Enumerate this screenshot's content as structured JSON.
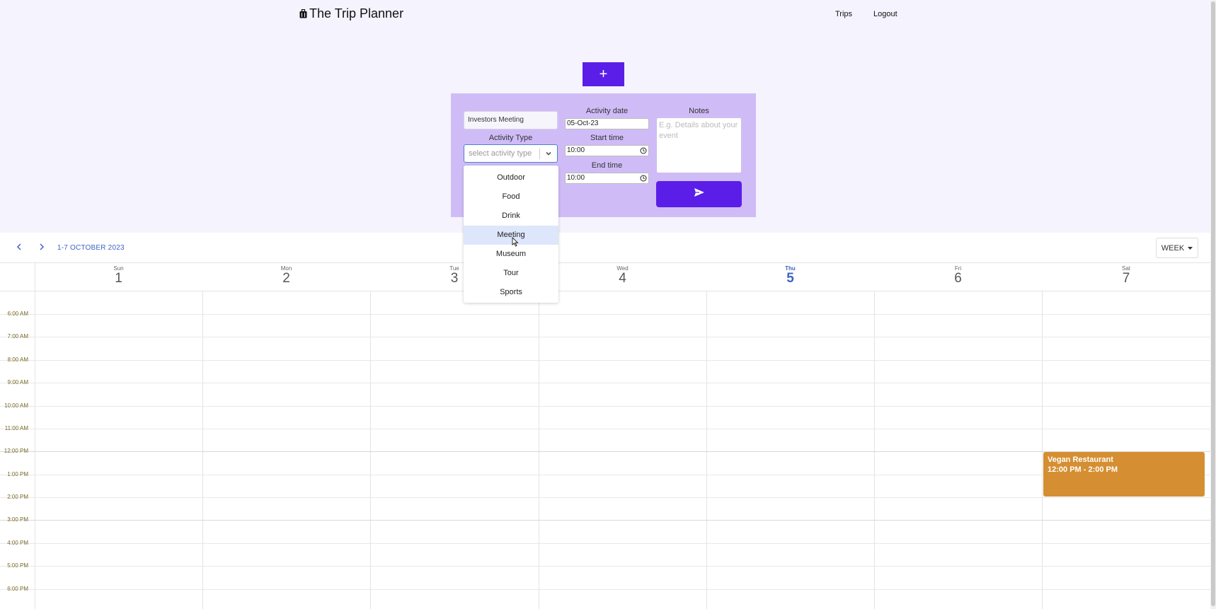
{
  "header": {
    "title": "The Trip Planner",
    "nav": {
      "trips": "Trips",
      "logout": "Logout"
    }
  },
  "add_button": {
    "label": "+"
  },
  "form": {
    "activity_name_value": "Investors Meeting",
    "activity_type_label": "Activity Type",
    "activity_type_placeholder": "select activity type",
    "activity_date_label": "Activity date",
    "activity_date_value": "05-Oct-23",
    "start_time_label": "Start time",
    "start_time_value": "10:00",
    "end_time_label": "End time",
    "end_time_value": "10:00",
    "notes_label": "Notes",
    "notes_placeholder": "E.g. Details about your event"
  },
  "dropdown": {
    "options": [
      "Outdoor",
      "Food",
      "Drink",
      "Meeting",
      "Museum",
      "Tour",
      "Sports"
    ],
    "highlighted": "Meeting"
  },
  "calendar": {
    "range_label": "1-7 OCTOBER 2023",
    "view_label": "WEEK",
    "days": [
      {
        "name": "Sun",
        "date": "1"
      },
      {
        "name": "Mon",
        "date": "2"
      },
      {
        "name": "Tue",
        "date": "3"
      },
      {
        "name": "Wed",
        "date": "4"
      },
      {
        "name": "Thu",
        "date": "5",
        "today": true
      },
      {
        "name": "Fri",
        "date": "6"
      },
      {
        "name": "Sat",
        "date": "7"
      }
    ],
    "times": [
      "6:00 AM",
      "7:00 AM",
      "8:00 AM",
      "9:00 AM",
      "10:00 AM",
      "11:00 AM",
      "12:00 PM",
      "1:00 PM",
      "2:00 PM",
      "3:00 PM",
      "4:00 PM",
      "5:00 PM",
      "6:00 PM"
    ],
    "event": {
      "title": "Vegan Restaurant",
      "time": "12:00 PM  -  2:00 PM",
      "color": "#d58f32"
    }
  },
  "colors": {
    "accent": "#5b1ee8",
    "panel": "#cfbcf7",
    "link": "#3f63c4"
  }
}
